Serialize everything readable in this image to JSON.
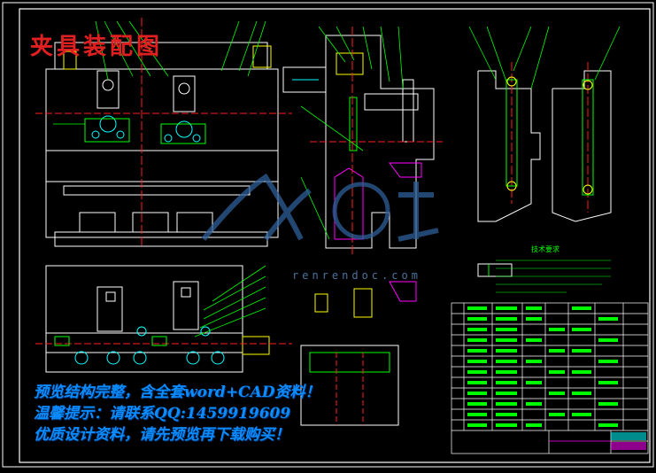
{
  "drawing": {
    "title_red": "夹具装配图",
    "watermark_text": "renrendoc.com",
    "ad_lines": [
      "预览结构完整，含全套word+CAD资料！",
      "温馨提示：请联系QQ:1459919609",
      "优质设计资料，请先预览再下载购买！"
    ],
    "notes_title": "技术要求",
    "colors": {
      "background": "#000000",
      "line_white": "#ffffff",
      "line_green": "#00ff00",
      "line_cyan": "#00ffff",
      "line_red": "#ff2020",
      "line_magenta": "#ff00ff",
      "line_yellow": "#ffff00",
      "ad_blue": "#0a8cff"
    }
  }
}
